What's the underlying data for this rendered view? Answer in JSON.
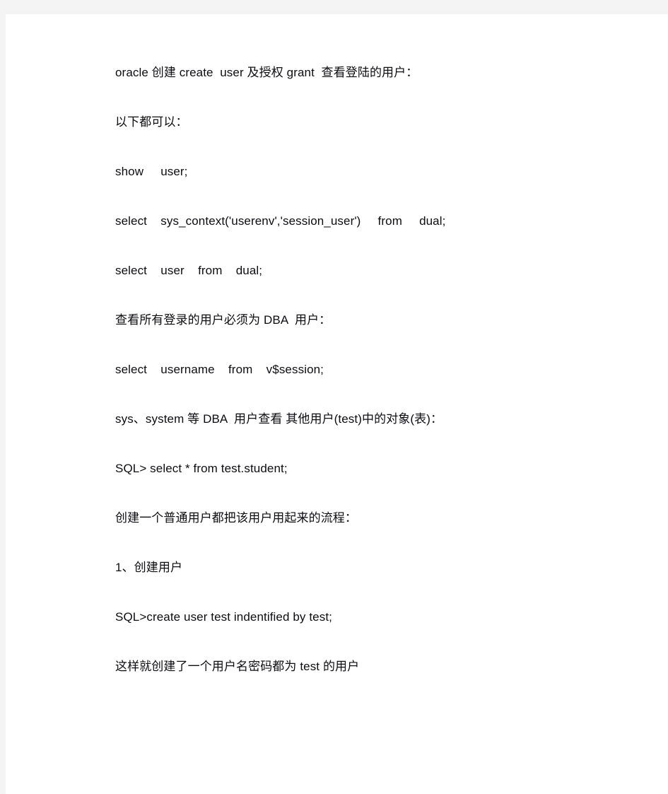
{
  "document": {
    "page_background": "#ffffff",
    "margin_background": "#f4f4f4",
    "text_color": "#0d0d12",
    "paragraphs": [
      {
        "id": "title-line",
        "text": "oracle 创建 create  user 及授权 grant  查看登陆的用户："
      },
      {
        "id": "intro-line",
        "text": "以下都可以："
      },
      {
        "id": "sql-show-user",
        "text": "show     user;"
      },
      {
        "id": "sql-sys-context",
        "text": "select    sys_context('userenv','session_user')     from     dual;"
      },
      {
        "id": "sql-select-user",
        "text": "select    user    from    dual;"
      },
      {
        "id": "note-dba-required",
        "text": "查看所有登录的用户必须为 DBA  用户："
      },
      {
        "id": "sql-v-session",
        "text": "select    username    from    v$session;"
      },
      {
        "id": "note-dba-objects",
        "text": "sys、system 等 DBA  用户查看 其他用户(test)中的对象(表)："
      },
      {
        "id": "sql-select-star",
        "text": "SQL> select * from test.student;"
      },
      {
        "id": "note-workflow",
        "text": "创建一个普通用户都把该用户用起来的流程："
      },
      {
        "id": "step-1-heading",
        "text": "1、创建用户"
      },
      {
        "id": "sql-create-user",
        "text": "SQL>create user test indentified by test;"
      },
      {
        "id": "note-created",
        "text": "这样就创建了一个用户名密码都为 test 的用户"
      }
    ]
  }
}
